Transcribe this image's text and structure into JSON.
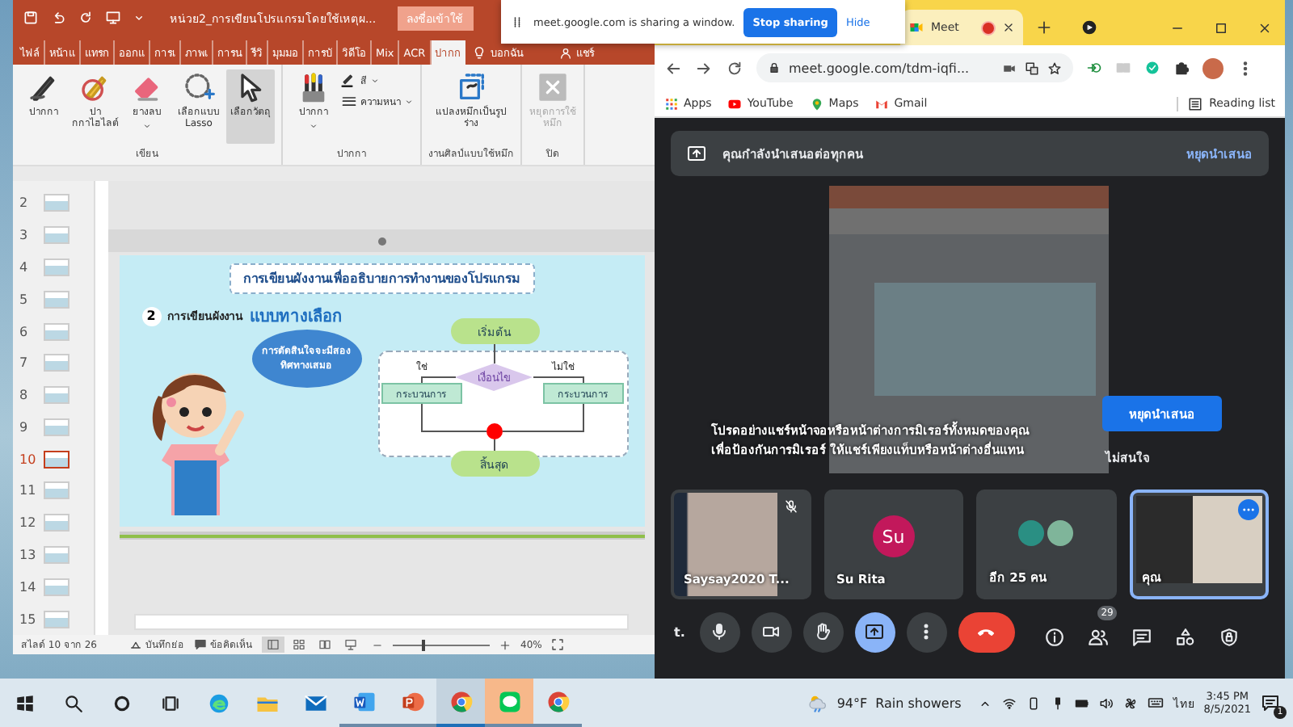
{
  "powerpoint": {
    "title": "หน่วย2_การเขียนโปรแกรมโดยใช้เหตุผ...",
    "sign_in": "ลงชื่อเข้าใช้",
    "tabs": [
      {
        "label": "ไฟล์",
        "selected": false
      },
      {
        "label": "หน้าแ",
        "selected": false
      },
      {
        "label": "แทรก",
        "selected": false
      },
      {
        "label": "ออกแ",
        "selected": false
      },
      {
        "label": "การเ",
        "selected": false
      },
      {
        "label": "ภาพเ",
        "selected": false
      },
      {
        "label": "การน",
        "selected": false
      },
      {
        "label": "รีวิ",
        "selected": false
      },
      {
        "label": "มุมมอ",
        "selected": false
      },
      {
        "label": "การบั",
        "selected": false
      },
      {
        "label": "วิดีโอ",
        "selected": false
      },
      {
        "label": "Mix",
        "selected": false
      },
      {
        "label": "ACR",
        "selected": false
      },
      {
        "label": "ปากก",
        "selected": true
      }
    ],
    "tell_me": "บอกฉัน",
    "share": "แชร์",
    "ribbon_groups": [
      {
        "label": "เขียน",
        "buttons": [
          {
            "kind": "pen",
            "label": "ปากกา",
            "selected": false,
            "disabled": false,
            "dropdown": false
          },
          {
            "kind": "highlighter",
            "label": "ปากกาไฮไลต์",
            "selected": false,
            "disabled": false,
            "dropdown": false
          },
          {
            "kind": "eraser",
            "label": "ยางลบ",
            "selected": false,
            "disabled": false,
            "dropdown": true
          },
          {
            "kind": "lasso",
            "label": "เลือกแบบ Lasso",
            "selected": false,
            "disabled": false,
            "dropdown": false
          },
          {
            "kind": "select",
            "label": "เลือกวัตถุ",
            "selected": true,
            "disabled": false,
            "dropdown": false
          }
        ]
      },
      {
        "label": "ปากกา",
        "buttons": [
          {
            "kind": "pens",
            "label": "ปากกา",
            "selected": false,
            "disabled": false,
            "dropdown": true
          }
        ],
        "options": [
          {
            "kind": "color",
            "label": "สี"
          },
          {
            "kind": "thickness",
            "label": "ความหนา"
          }
        ]
      },
      {
        "label": "งานศิลป์แบบใช้หมึก",
        "buttons": [
          {
            "kind": "convert",
            "label": "แปลงหมึกเป็นรูปร่าง",
            "selected": false,
            "disabled": false,
            "dropdown": false
          }
        ]
      },
      {
        "label": "ปิด",
        "buttons": [
          {
            "kind": "stop",
            "label": "หยุดการใช้หมึก",
            "selected": false,
            "disabled": true,
            "dropdown": false
          }
        ]
      }
    ],
    "slides": [
      {
        "number": "2",
        "selected": false
      },
      {
        "number": "3",
        "selected": false
      },
      {
        "number": "4",
        "selected": false
      },
      {
        "number": "5",
        "selected": false
      },
      {
        "number": "6",
        "selected": false
      },
      {
        "number": "7",
        "selected": false
      },
      {
        "number": "8",
        "selected": false
      },
      {
        "number": "9",
        "selected": false
      },
      {
        "number": "10",
        "selected": true
      },
      {
        "number": "11",
        "selected": false
      },
      {
        "number": "12",
        "selected": false
      },
      {
        "number": "13",
        "selected": false
      },
      {
        "number": "14",
        "selected": false
      },
      {
        "number": "15",
        "selected": false
      }
    ],
    "slide": {
      "media": {
        "level": 1
      },
      "title": "การเขียนผังงานเพื่ออธิบายการทำงานของโปรแกรม",
      "step": "2",
      "heading": "การเขียนผังงาน",
      "heading_highlight": "แบบทางเลือก",
      "bubble": "การตัดสินใจจะมีสองทิศทางเสมอ",
      "flowchart": {
        "start": "เริ่มต้น",
        "condition": "เงื่อนไข",
        "yes": "ใช่",
        "no": "ไม่ใช่",
        "process_left": "กระบวนการ",
        "process_right": "กระบวนการ",
        "end": "สิ้นสุด"
      }
    },
    "status_bar": {
      "slide_info": "สไลด์ 10 จาก 26",
      "notes": "บันทึกย่อ",
      "comments": "ข้อคิดเห็น",
      "views": [
        {
          "kind": "normal",
          "selected": true
        },
        {
          "kind": "sorter",
          "selected": false
        },
        {
          "kind": "reading",
          "selected": false
        },
        {
          "kind": "slideshow",
          "selected": false
        }
      ],
      "zoom": {
        "level": 0.3
      },
      "zoom_label": "40%"
    }
  },
  "share_banner": {
    "text": "meet.google.com is sharing a window.",
    "stop": "Stop sharing",
    "hide": "Hide"
  },
  "chrome": {
    "tab": {
      "title": "Meet",
      "recording": true
    },
    "url": "meet.google.com/tdm-iqfi...",
    "bookmarks": [
      {
        "kind": "apps",
        "label": "Apps"
      },
      {
        "kind": "youtube",
        "label": "YouTube"
      },
      {
        "kind": "maps",
        "label": "Maps"
      },
      {
        "kind": "gmail",
        "label": "Gmail"
      }
    ],
    "reading_list": "Reading list"
  },
  "meet": {
    "banner": {
      "text": "คุณกำลังนำเสนอต่อทุกคน",
      "action": "หยุดนำเสนอ"
    },
    "warning": {
      "text": "โปรดอย่างแชร์หน้าจอหรือหน้าต่างการมิเรอร์ทั้งหมดของคุณ\nเพื่อป้องกันการมิเรอร์ ให้แชร์เพียงแท็บหรือหน้าต่างอื่นแทน",
      "stop": "หยุดนำเสนอ",
      "dismiss": "ไม่สนใจ"
    },
    "tiles": [
      {
        "kind": "video",
        "name": "Saysay2020 T...",
        "muted": true,
        "selected": false
      },
      {
        "kind": "avatar",
        "name": "Su Rita",
        "initials": "Su",
        "color": "#c2185b",
        "muted": false,
        "selected": false
      },
      {
        "kind": "group",
        "name": "อีก 25 คน",
        "muted": false,
        "selected": false
      },
      {
        "kind": "self",
        "name": "คุณ",
        "muted": false,
        "selected": true
      }
    ],
    "meeting_code": "t.",
    "controls": [
      {
        "kind": "mic",
        "selected": false
      },
      {
        "kind": "camera",
        "selected": false
      },
      {
        "kind": "hand",
        "selected": false
      },
      {
        "kind": "present",
        "selected": true
      },
      {
        "kind": "more",
        "selected": false
      },
      {
        "kind": "end",
        "selected": false
      }
    ],
    "side_controls": [
      {
        "kind": "info"
      },
      {
        "kind": "people",
        "badge": "29"
      },
      {
        "kind": "chat"
      },
      {
        "kind": "activities"
      },
      {
        "kind": "security"
      }
    ]
  },
  "taskbar": {
    "apps": [
      {
        "kind": "edge",
        "running": false,
        "active": false,
        "flashing": false
      },
      {
        "kind": "explorer",
        "running": false,
        "active": false,
        "flashing": false
      },
      {
        "kind": "mail",
        "running": false,
        "active": false,
        "flashing": false
      },
      {
        "kind": "word",
        "running": true,
        "active": false,
        "flashing": false
      },
      {
        "kind": "powerpoint",
        "running": true,
        "active": false,
        "flashing": false
      },
      {
        "kind": "chrome",
        "running": true,
        "active": true,
        "flashing": false
      },
      {
        "kind": "line",
        "running": true,
        "active": false,
        "flashing": true
      },
      {
        "kind": "chrome",
        "running": true,
        "active": false,
        "flashing": false
      }
    ],
    "weather_temp": "94°F",
    "weather_text": "Rain showers",
    "language": "ไทย",
    "time": "3:45 PM",
    "date": "8/5/2021",
    "notifications": "1"
  }
}
